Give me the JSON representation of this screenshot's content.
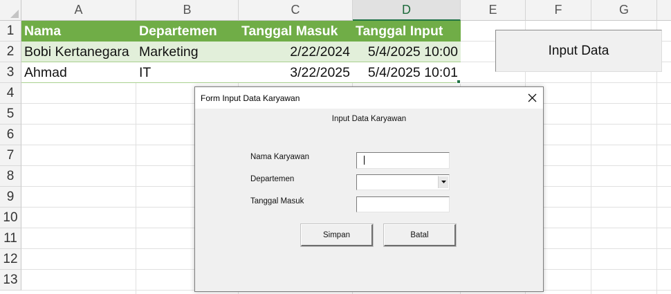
{
  "columns": [
    "A",
    "B",
    "C",
    "D",
    "E",
    "F",
    "G"
  ],
  "rows": [
    "1",
    "2",
    "3",
    "4",
    "5",
    "6",
    "7",
    "8",
    "9",
    "10",
    "11",
    "12",
    "13"
  ],
  "table": {
    "headers": [
      "Nama",
      "Departemen",
      "Tanggal Masuk",
      "Tanggal Input"
    ],
    "data": [
      [
        "Bobi Kertanegara",
        "Marketing",
        "2/22/2024",
        "5/4/2025 10:00"
      ],
      [
        "Ahmad",
        "IT",
        "3/22/2025",
        "5/4/2025 10:01"
      ]
    ]
  },
  "sheet_button": {
    "label": "Input Data"
  },
  "dialog": {
    "title": "Form Input Data Karyawan",
    "heading": "Input Data Karyawan",
    "fields": {
      "nama_label": "Nama Karyawan",
      "nama_value": "",
      "departemen_label": "Departemen",
      "departemen_value": "",
      "tanggal_label": "Tanggal Masuk",
      "tanggal_value": ""
    },
    "buttons": {
      "simpan": "Simpan",
      "batal": "Batal"
    }
  },
  "colors": {
    "table_header": "#70ad47",
    "table_band": "#e2efda",
    "excel_green": "#217346"
  },
  "icons": [
    "close-icon",
    "dropdown-arrow-icon"
  ]
}
